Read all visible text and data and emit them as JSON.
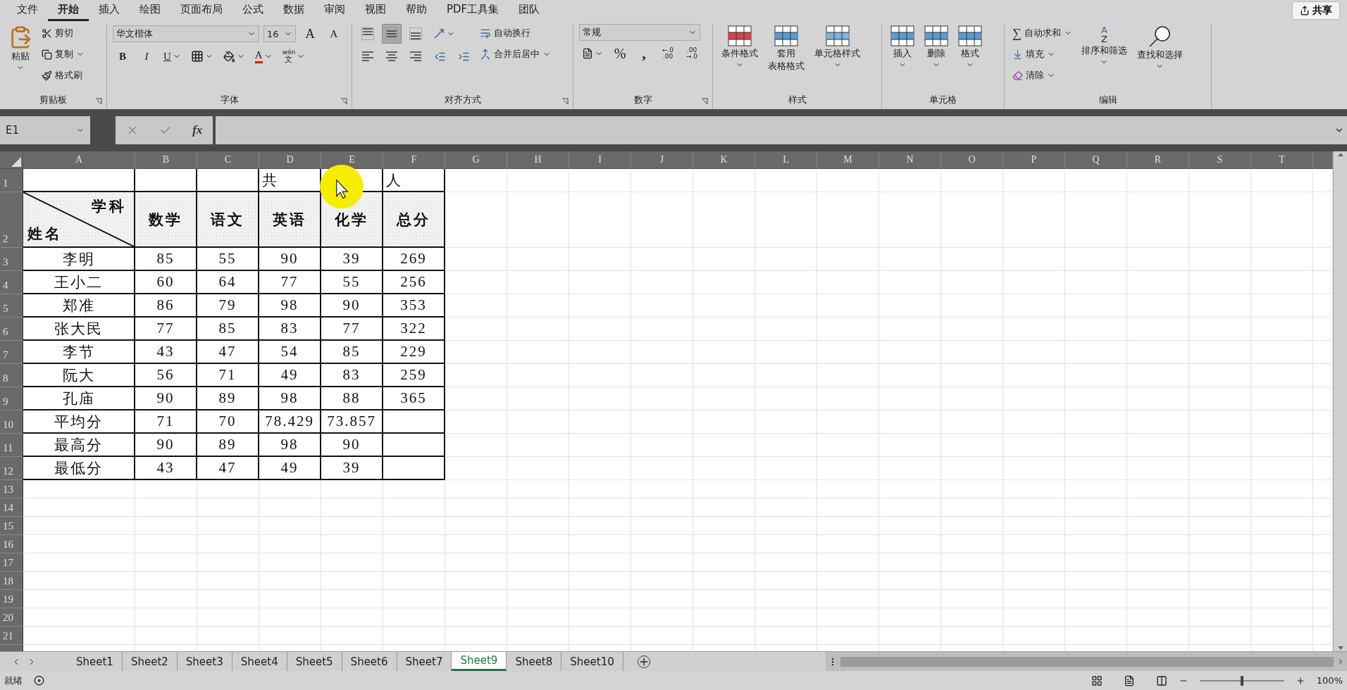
{
  "menu_tabs": [
    {
      "label": "文件",
      "selected": false
    },
    {
      "label": "开始",
      "selected": true
    },
    {
      "label": "插入",
      "selected": false
    },
    {
      "label": "绘图",
      "selected": false
    },
    {
      "label": "页面布局",
      "selected": false
    },
    {
      "label": "公式",
      "selected": false
    },
    {
      "label": "数据",
      "selected": false
    },
    {
      "label": "审阅",
      "selected": false
    },
    {
      "label": "视图",
      "selected": false
    },
    {
      "label": "帮助",
      "selected": false
    },
    {
      "label": "PDF工具集",
      "selected": false
    },
    {
      "label": "团队",
      "selected": false
    }
  ],
  "share_button": "共享",
  "ribbon": {
    "clipboard": {
      "title": "剪贴板",
      "paste": "粘贴",
      "cut": "剪切",
      "copy": "复制",
      "format_painter": "格式刷"
    },
    "font": {
      "title": "字体",
      "font_name": "华文楷体",
      "font_size": "16",
      "grow": "A",
      "shrink": "A",
      "bold": "B",
      "italic": "I",
      "underline": "U",
      "font_color": "A",
      "phonetic_top": "wén",
      "phonetic_bottom": "文"
    },
    "alignment": {
      "title": "对齐方式",
      "vertical": [
        {
          "kind": "top",
          "selected": false
        },
        {
          "kind": "middle",
          "selected": true
        },
        {
          "kind": "bottom",
          "selected": false
        }
      ],
      "horizontal": [
        {
          "kind": "left",
          "selected": false
        },
        {
          "kind": "center",
          "selected": false
        },
        {
          "kind": "right",
          "selected": false
        }
      ],
      "wrap_text": "自动换行",
      "merge_center": "合并后居中"
    },
    "number": {
      "title": "数字",
      "format": "常规",
      "percent": "%",
      "comma": ",",
      "increase_decimal": [
        "←.0",
        ".00"
      ],
      "decrease_decimal": [
        ".00",
        "→.0"
      ]
    },
    "styles": {
      "title": "样式",
      "conditional": "条件格式",
      "table_format": [
        "套用",
        "表格格式"
      ],
      "cell_styles": "单元格样式"
    },
    "cells": {
      "title": "单元格",
      "insert": "插入",
      "delete": "删除",
      "format": "格式"
    },
    "editing": {
      "title": "编辑",
      "autosum_symbol": "∑",
      "autosum": "自动求和",
      "fill": "填充",
      "clear": "清除",
      "sort_letters": [
        "A",
        "Z"
      ],
      "sort_filter": "排序和筛选",
      "find_select": "查找和选择"
    }
  },
  "formula_bar": {
    "name_box": "E1",
    "fx": "fx"
  },
  "sheet": {
    "columns": [
      "A",
      "B",
      "C",
      "D",
      "E",
      "F",
      "G",
      "H",
      "I",
      "J",
      "K",
      "L",
      "M",
      "N",
      "O",
      "P",
      "Q",
      "R",
      "S",
      "T"
    ],
    "row_numbers": [
      "1",
      "2",
      "3",
      "4",
      "5",
      "6",
      "7",
      "8",
      "9",
      "10",
      "11",
      "12",
      "13",
      "14",
      "15",
      "16",
      "17",
      "18",
      "19",
      "20",
      "21"
    ],
    "title_row": {
      "D": "共",
      "F": "人"
    },
    "header_row": {
      "diagonal_top": "学科",
      "diagonal_bottom": "姓名",
      "subjects": [
        "数学",
        "语文",
        "英语",
        "化学",
        "总分"
      ]
    },
    "rows": [
      [
        "李明",
        "85",
        "55",
        "90",
        "39",
        "269"
      ],
      [
        "王小二",
        "60",
        "64",
        "77",
        "55",
        "256"
      ],
      [
        "郑准",
        "86",
        "79",
        "98",
        "90",
        "353"
      ],
      [
        "张大民",
        "77",
        "85",
        "83",
        "77",
        "322"
      ],
      [
        "李节",
        "43",
        "47",
        "54",
        "85",
        "229"
      ],
      [
        "阮大",
        "56",
        "71",
        "49",
        "83",
        "259"
      ],
      [
        "孔庙",
        "90",
        "89",
        "98",
        "88",
        "365"
      ],
      [
        "平均分",
        "71",
        "70",
        "78.429",
        "73.857"
      ],
      [
        "最高分",
        "90",
        "89",
        "98",
        "90"
      ],
      [
        "最低分",
        "43",
        "47",
        "49",
        "39"
      ]
    ]
  },
  "sheet_tabs": [
    {
      "label": "Sheet1",
      "selected": false
    },
    {
      "label": "Sheet2",
      "selected": false
    },
    {
      "label": "Sheet3",
      "selected": false
    },
    {
      "label": "Sheet4",
      "selected": false
    },
    {
      "label": "Sheet5",
      "selected": false
    },
    {
      "label": "Sheet6",
      "selected": false
    },
    {
      "label": "Sheet7",
      "selected": false
    },
    {
      "label": "Sheet9",
      "selected": true
    },
    {
      "label": "Sheet8",
      "selected": false
    },
    {
      "label": "Sheet10",
      "selected": false
    }
  ],
  "status_bar": {
    "status": "就绪",
    "zoom": "100%",
    "zoom_slider": {
      "level": 0.5
    }
  }
}
